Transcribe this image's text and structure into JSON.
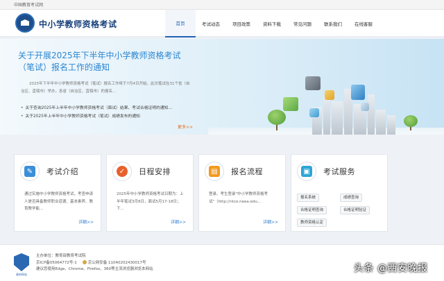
{
  "topbar": {
    "text": "中国教育考试网"
  },
  "header": {
    "site_title": "中小学教师资格考试"
  },
  "nav": [
    "首页",
    "考试动态",
    "项目政策",
    "资料下载",
    "常见问题",
    "联系我们",
    "在线客服"
  ],
  "banner": {
    "title": "关于开展2025年下半年中小学教师资格考试（笔试）报名工作的通知",
    "desc": "2025年下半年中小学教师资格考试（笔试）报名工作将于7月4日开始。此次笔试在31个省（自治区、直辖市）举办，各省（自治区、直辖市）的报名...",
    "list": [
      "关于查询2025年上半年中小学教师资格考试（面试）结果、考试合格证明的通知...",
      "关于2025年上半年中小学教师资格考试（笔试）成绩发布的通知"
    ],
    "more": "更多>>"
  },
  "cards": [
    {
      "title": "考试介绍",
      "text": "通过实施中小学教师资格考试，考查申请人是否具备教师职业道德、基本素养、教育教学能...",
      "more": "详细>>",
      "icon": "book-icon",
      "color": "#3a8fd8"
    },
    {
      "title": "日程安排",
      "text": "2025年中小学教师资格考试日期为：上半年笔试3月8日，面试5月17-18日；下...",
      "more": "详细>>",
      "icon": "check-icon",
      "color": "#e8602c"
    },
    {
      "title": "报名流程",
      "text": "登录、考生登录\"中小学教师资格考试\"（http://ntce.neea.edu...",
      "more": "详细>>",
      "icon": "form-icon",
      "color": "#f29a1f"
    },
    {
      "title": "考试服务",
      "icon": "user-card-icon",
      "color": "#2ba6d6",
      "buttons": [
        "报名系统",
        "成绩查询",
        "合格证明查询",
        "合格证明验证",
        "教师资格认定"
      ]
    }
  ],
  "footer": {
    "logo_text": "政府网站",
    "line1": "主办单位：教育部教育考试院",
    "icp": "京ICP备05064772号-1",
    "police": "京公网安备 11040202430017号",
    "browsers": "建议您使用Edge、Chrome、Firefox、360等主流浏览器浏览本网站"
  },
  "watermark": "头条 @西安晚报"
}
